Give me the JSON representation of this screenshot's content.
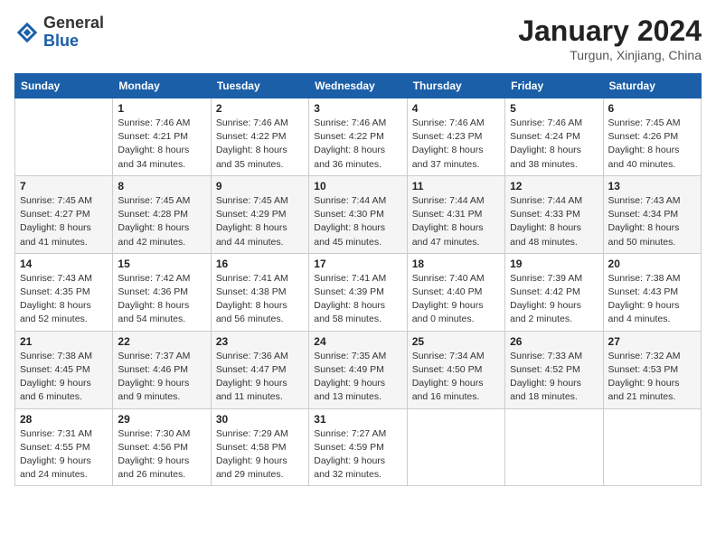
{
  "header": {
    "logo": {
      "general": "General",
      "blue": "Blue"
    },
    "title": "January 2024",
    "location": "Turgun, Xinjiang, China"
  },
  "weekdays": [
    "Sunday",
    "Monday",
    "Tuesday",
    "Wednesday",
    "Thursday",
    "Friday",
    "Saturday"
  ],
  "weeks": [
    [
      null,
      {
        "day": "1",
        "sunrise": "7:46 AM",
        "sunset": "4:21 PM",
        "daylight": "8 hours and 34 minutes."
      },
      {
        "day": "2",
        "sunrise": "7:46 AM",
        "sunset": "4:22 PM",
        "daylight": "8 hours and 35 minutes."
      },
      {
        "day": "3",
        "sunrise": "7:46 AM",
        "sunset": "4:22 PM",
        "daylight": "8 hours and 36 minutes."
      },
      {
        "day": "4",
        "sunrise": "7:46 AM",
        "sunset": "4:23 PM",
        "daylight": "8 hours and 37 minutes."
      },
      {
        "day": "5",
        "sunrise": "7:46 AM",
        "sunset": "4:24 PM",
        "daylight": "8 hours and 38 minutes."
      },
      {
        "day": "6",
        "sunrise": "7:45 AM",
        "sunset": "4:26 PM",
        "daylight": "8 hours and 40 minutes."
      }
    ],
    [
      {
        "day": "7",
        "sunrise": "7:45 AM",
        "sunset": "4:27 PM",
        "daylight": "8 hours and 41 minutes."
      },
      {
        "day": "8",
        "sunrise": "7:45 AM",
        "sunset": "4:28 PM",
        "daylight": "8 hours and 42 minutes."
      },
      {
        "day": "9",
        "sunrise": "7:45 AM",
        "sunset": "4:29 PM",
        "daylight": "8 hours and 44 minutes."
      },
      {
        "day": "10",
        "sunrise": "7:44 AM",
        "sunset": "4:30 PM",
        "daylight": "8 hours and 45 minutes."
      },
      {
        "day": "11",
        "sunrise": "7:44 AM",
        "sunset": "4:31 PM",
        "daylight": "8 hours and 47 minutes."
      },
      {
        "day": "12",
        "sunrise": "7:44 AM",
        "sunset": "4:33 PM",
        "daylight": "8 hours and 48 minutes."
      },
      {
        "day": "13",
        "sunrise": "7:43 AM",
        "sunset": "4:34 PM",
        "daylight": "8 hours and 50 minutes."
      }
    ],
    [
      {
        "day": "14",
        "sunrise": "7:43 AM",
        "sunset": "4:35 PM",
        "daylight": "8 hours and 52 minutes."
      },
      {
        "day": "15",
        "sunrise": "7:42 AM",
        "sunset": "4:36 PM",
        "daylight": "8 hours and 54 minutes."
      },
      {
        "day": "16",
        "sunrise": "7:41 AM",
        "sunset": "4:38 PM",
        "daylight": "8 hours and 56 minutes."
      },
      {
        "day": "17",
        "sunrise": "7:41 AM",
        "sunset": "4:39 PM",
        "daylight": "8 hours and 58 minutes."
      },
      {
        "day": "18",
        "sunrise": "7:40 AM",
        "sunset": "4:40 PM",
        "daylight": "9 hours and 0 minutes."
      },
      {
        "day": "19",
        "sunrise": "7:39 AM",
        "sunset": "4:42 PM",
        "daylight": "9 hours and 2 minutes."
      },
      {
        "day": "20",
        "sunrise": "7:38 AM",
        "sunset": "4:43 PM",
        "daylight": "9 hours and 4 minutes."
      }
    ],
    [
      {
        "day": "21",
        "sunrise": "7:38 AM",
        "sunset": "4:45 PM",
        "daylight": "9 hours and 6 minutes."
      },
      {
        "day": "22",
        "sunrise": "7:37 AM",
        "sunset": "4:46 PM",
        "daylight": "9 hours and 9 minutes."
      },
      {
        "day": "23",
        "sunrise": "7:36 AM",
        "sunset": "4:47 PM",
        "daylight": "9 hours and 11 minutes."
      },
      {
        "day": "24",
        "sunrise": "7:35 AM",
        "sunset": "4:49 PM",
        "daylight": "9 hours and 13 minutes."
      },
      {
        "day": "25",
        "sunrise": "7:34 AM",
        "sunset": "4:50 PM",
        "daylight": "9 hours and 16 minutes."
      },
      {
        "day": "26",
        "sunrise": "7:33 AM",
        "sunset": "4:52 PM",
        "daylight": "9 hours and 18 minutes."
      },
      {
        "day": "27",
        "sunrise": "7:32 AM",
        "sunset": "4:53 PM",
        "daylight": "9 hours and 21 minutes."
      }
    ],
    [
      {
        "day": "28",
        "sunrise": "7:31 AM",
        "sunset": "4:55 PM",
        "daylight": "9 hours and 24 minutes."
      },
      {
        "day": "29",
        "sunrise": "7:30 AM",
        "sunset": "4:56 PM",
        "daylight": "9 hours and 26 minutes."
      },
      {
        "day": "30",
        "sunrise": "7:29 AM",
        "sunset": "4:58 PM",
        "daylight": "9 hours and 29 minutes."
      },
      {
        "day": "31",
        "sunrise": "7:27 AM",
        "sunset": "4:59 PM",
        "daylight": "9 hours and 32 minutes."
      },
      null,
      null,
      null
    ]
  ],
  "labels": {
    "sunrise": "Sunrise:",
    "sunset": "Sunset:",
    "daylight": "Daylight:"
  }
}
